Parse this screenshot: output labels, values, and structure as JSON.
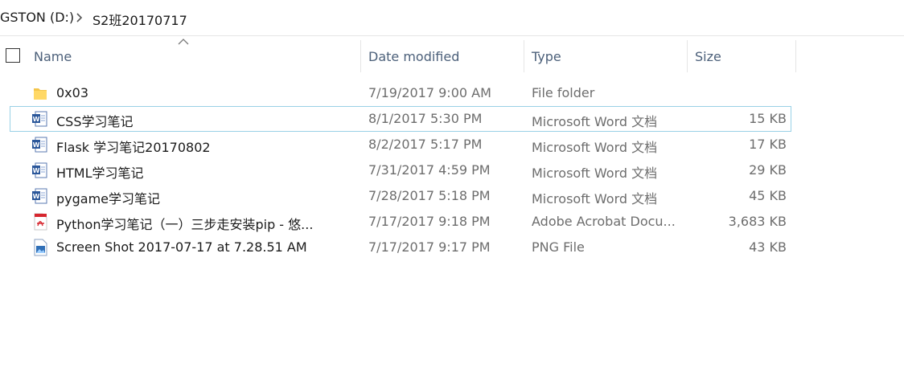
{
  "breadcrumb": {
    "drive": "GSTON (D:)",
    "folder": "S2班20170717"
  },
  "columns": {
    "name": "Name",
    "date_modified": "Date modified",
    "type": "Type",
    "size": "Size"
  },
  "files": [
    {
      "name": "0x03",
      "date": "7/19/2017 9:00 AM",
      "type": "File folder",
      "size": "",
      "icon": "folder-icon"
    },
    {
      "name": "CSS学习笔记",
      "date": "8/1/2017 5:30 PM",
      "type": "Microsoft Word 文档",
      "size": "15 KB",
      "icon": "word-doc-icon"
    },
    {
      "name": "Flask 学习笔记20170802",
      "date": "8/2/2017 5:17 PM",
      "type": "Microsoft Word 文档",
      "size": "17 KB",
      "icon": "word-doc-icon"
    },
    {
      "name": "HTML学习笔记",
      "date": "7/31/2017 4:59 PM",
      "type": "Microsoft Word 文档",
      "size": "29 KB",
      "icon": "word-doc-icon"
    },
    {
      "name": "pygame学习笔记",
      "date": "7/28/2017 5:18 PM",
      "type": "Microsoft Word 文档",
      "size": "45 KB",
      "icon": "word-doc-icon"
    },
    {
      "name": "Python学习笔记（一）三步走安装pip - 悠...",
      "date": "7/17/2017 9:18 PM",
      "type": "Adobe Acrobat Docu...",
      "size": "3,683 KB",
      "icon": "pdf-icon"
    },
    {
      "name": "Screen Shot 2017-07-17 at 7.28.51 AM",
      "date": "7/17/2017 9:17 PM",
      "type": "PNG File",
      "size": "43 KB",
      "icon": "image-file-icon"
    }
  ],
  "colors": {
    "header_text": "#4c607a",
    "selection_border": "#99d1e6",
    "secondary_text": "#6d6d6d"
  }
}
